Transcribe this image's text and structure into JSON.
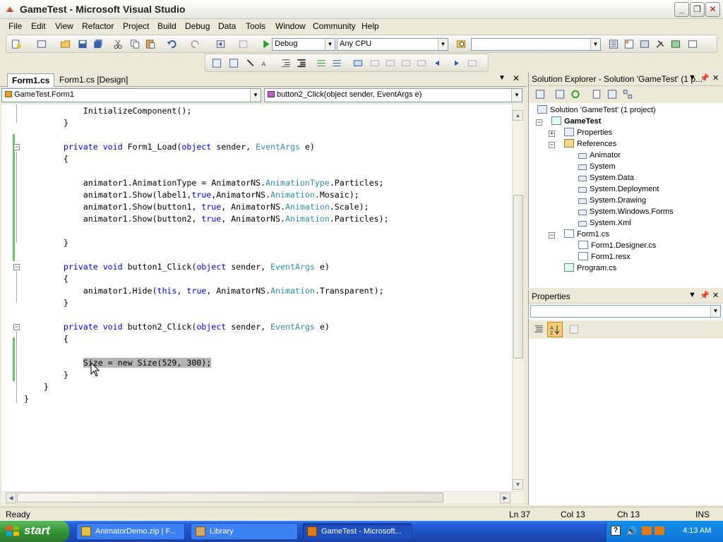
{
  "window": {
    "title": "GameTest - Microsoft Visual Studio"
  },
  "menu": [
    "File",
    "Edit",
    "View",
    "Refactor",
    "Project",
    "Build",
    "Debug",
    "Data",
    "Tools",
    "Window",
    "Community",
    "Help"
  ],
  "toolbar": {
    "config": "Debug",
    "platform": "Any CPU",
    "find": ""
  },
  "tabs": [
    "Form1.cs",
    "Form1.cs [Design]"
  ],
  "navbar": {
    "type": "GameTest.Form1",
    "member": "button2_Click(object sender, EventArgs e)"
  },
  "code": {
    "lines": [
      [
        [
          "t",
          "            InitializeComponent();"
        ]
      ],
      [
        [
          "t",
          "        }"
        ]
      ],
      [
        [
          "t",
          ""
        ]
      ],
      [
        [
          "t",
          "        "
        ],
        [
          "k",
          "private"
        ],
        [
          "t",
          " "
        ],
        [
          "k",
          "void"
        ],
        [
          "t",
          " Form1_Load("
        ],
        [
          "k",
          "object"
        ],
        [
          "t",
          " sender, "
        ],
        [
          "y",
          "EventArgs"
        ],
        [
          "t",
          " e)"
        ]
      ],
      [
        [
          "t",
          "        {"
        ]
      ],
      [
        [
          "t",
          ""
        ]
      ],
      [
        [
          "t",
          "            animator1.AnimationType = AnimatorNS."
        ],
        [
          "y",
          "AnimationType"
        ],
        [
          "t",
          ".Particles;"
        ]
      ],
      [
        [
          "t",
          "            animator1.Show(label1,"
        ],
        [
          "k",
          "true"
        ],
        [
          "t",
          ",AnimatorNS."
        ],
        [
          "y",
          "Animation"
        ],
        [
          "t",
          ".Mosaic);"
        ]
      ],
      [
        [
          "t",
          "            animator1.Show(button1, "
        ],
        [
          "k",
          "true"
        ],
        [
          "t",
          ", AnimatorNS."
        ],
        [
          "y",
          "Animation"
        ],
        [
          "t",
          ".Scale);"
        ]
      ],
      [
        [
          "t",
          "            animator1.Show(button2, "
        ],
        [
          "k",
          "true"
        ],
        [
          "t",
          ", AnimatorNS."
        ],
        [
          "y",
          "Animation"
        ],
        [
          "t",
          ".Particles);"
        ]
      ],
      [
        [
          "t",
          ""
        ]
      ],
      [
        [
          "t",
          "        }"
        ]
      ],
      [
        [
          "t",
          ""
        ]
      ],
      [
        [
          "t",
          "        "
        ],
        [
          "k",
          "private"
        ],
        [
          "t",
          " "
        ],
        [
          "k",
          "void"
        ],
        [
          "t",
          " button1_Click("
        ],
        [
          "k",
          "object"
        ],
        [
          "t",
          " sender, "
        ],
        [
          "y",
          "EventArgs"
        ],
        [
          "t",
          " e)"
        ]
      ],
      [
        [
          "t",
          "        {"
        ]
      ],
      [
        [
          "t",
          "            animator1.Hide("
        ],
        [
          "k",
          "this"
        ],
        [
          "t",
          ", "
        ],
        [
          "k",
          "true"
        ],
        [
          "t",
          ", AnimatorNS."
        ],
        [
          "y",
          "Animation"
        ],
        [
          "t",
          ".Transparent);"
        ]
      ],
      [
        [
          "t",
          "        }"
        ]
      ],
      [
        [
          "t",
          ""
        ]
      ],
      [
        [
          "t",
          "        "
        ],
        [
          "k",
          "private"
        ],
        [
          "t",
          " "
        ],
        [
          "k",
          "void"
        ],
        [
          "t",
          " button2_Click("
        ],
        [
          "k",
          "object"
        ],
        [
          "t",
          " sender, "
        ],
        [
          "y",
          "EventArgs"
        ],
        [
          "t",
          " e)"
        ]
      ],
      [
        [
          "t",
          "        {"
        ]
      ],
      [
        [
          "t",
          ""
        ]
      ],
      [
        [
          "t",
          "            "
        ],
        [
          "s",
          "Size = new Size(529, 300);"
        ]
      ],
      [
        [
          "t",
          "        }"
        ]
      ],
      [
        [
          "t",
          "    }"
        ]
      ],
      [
        [
          "t",
          "}"
        ]
      ]
    ]
  },
  "solution_explorer": {
    "title": "Solution Explorer - Solution 'GameTest' (1 p...",
    "items": [
      {
        "label": "Solution 'GameTest' (1 project)",
        "level": 0,
        "icon": "solution-icon"
      },
      {
        "label": "GameTest",
        "level": 1,
        "icon": "csharp-project-icon",
        "bold": true
      },
      {
        "label": "Properties",
        "level": 2,
        "icon": "properties-icon"
      },
      {
        "label": "References",
        "level": 2,
        "icon": "folder-icon"
      },
      {
        "label": "Animator",
        "level": 3,
        "icon": "reference-icon"
      },
      {
        "label": "System",
        "level": 3,
        "icon": "reference-icon"
      },
      {
        "label": "System.Data",
        "level": 3,
        "icon": "reference-icon"
      },
      {
        "label": "System.Deployment",
        "level": 3,
        "icon": "reference-icon"
      },
      {
        "label": "System.Drawing",
        "level": 3,
        "icon": "reference-icon"
      },
      {
        "label": "System.Windows.Forms",
        "level": 3,
        "icon": "reference-icon"
      },
      {
        "label": "System.Xml",
        "level": 3,
        "icon": "reference-icon"
      },
      {
        "label": "Form1.cs",
        "level": 2,
        "icon": "form-icon"
      },
      {
        "label": "Form1.Designer.cs",
        "level": 3,
        "icon": "cs-file-icon"
      },
      {
        "label": "Form1.resx",
        "level": 3,
        "icon": "resx-file-icon"
      },
      {
        "label": "Program.cs",
        "level": 2,
        "icon": "cs-file-icon"
      }
    ]
  },
  "properties_panel": {
    "title": "Properties"
  },
  "status": {
    "text": "Ready",
    "ln": "Ln 37",
    "col": "Col 13",
    "ch": "Ch 13",
    "mode": "INS"
  },
  "taskbar": {
    "start": "start",
    "tasks": [
      "AnimatorDemo.zip | F...",
      "Library",
      "GameTest - Microsoft..."
    ],
    "clock": "4:13 AM"
  }
}
